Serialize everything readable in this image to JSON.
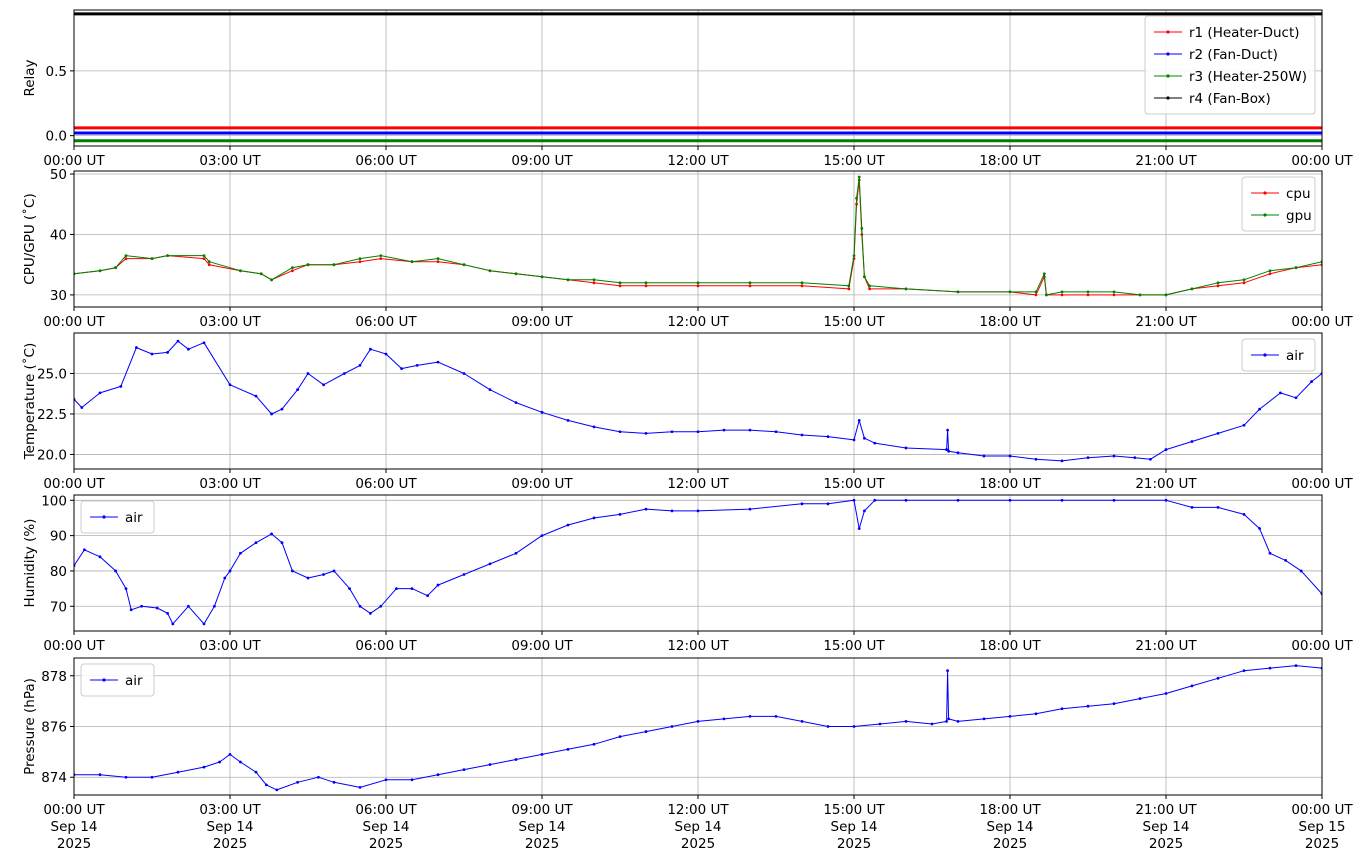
{
  "chart_data": [
    {
      "type": "line",
      "ylabel": "Relay",
      "ylim": [
        -0.08,
        0.97
      ],
      "yticks": [
        0.0,
        0.5
      ],
      "yticklabels": [
        "0.0",
        "0.5"
      ],
      "grid": true,
      "legend_loc": "upper-right",
      "series": [
        {
          "name": "r1 (Heater-Duct)",
          "color": "#ff0000",
          "x": [
            0,
            24
          ],
          "y": [
            0.06,
            0.06
          ]
        },
        {
          "name": "r2 (Fan-Duct)",
          "color": "#0000ff",
          "x": [
            0,
            24
          ],
          "y": [
            0.02,
            0.02
          ]
        },
        {
          "name": "r3 (Heater-250W)",
          "color": "#008000",
          "x": [
            0,
            24
          ],
          "y": [
            -0.04,
            -0.04
          ]
        },
        {
          "name": "r4 (Fan-Box)",
          "color": "#000000",
          "x": [
            0,
            24
          ],
          "y": [
            0.94,
            0.94
          ]
        }
      ]
    },
    {
      "type": "line",
      "ylabel": "CPU/GPU (˚C)",
      "ylim": [
        28,
        50.5
      ],
      "yticks": [
        30,
        40,
        50
      ],
      "yticklabels": [
        "30",
        "40",
        "50"
      ],
      "grid": true,
      "legend_loc": "upper-right",
      "series": [
        {
          "name": "cpu",
          "color": "#ff0000",
          "x": [
            0,
            0.5,
            0.8,
            1.0,
            1.5,
            1.8,
            2.5,
            2.6,
            3.2,
            3.6,
            3.8,
            4.2,
            4.5,
            5.0,
            5.5,
            5.9,
            6.5,
            7.0,
            7.5,
            8.0,
            8.5,
            9.0,
            9.5,
            10.0,
            10.5,
            11.0,
            12.0,
            13.0,
            14.0,
            14.9,
            15.0,
            15.05,
            15.1,
            15.15,
            15.2,
            15.3,
            16.0,
            17.0,
            18.0,
            18.5,
            18.66,
            18.7,
            19.0,
            19.5,
            20.0,
            20.5,
            21.0,
            21.5,
            22.0,
            22.5,
            23.0,
            23.5,
            24.0
          ],
          "y": [
            33.5,
            34.0,
            34.5,
            36.0,
            36.0,
            36.5,
            36.0,
            35.0,
            34.0,
            33.5,
            32.5,
            34.0,
            35.0,
            35.0,
            35.5,
            36.0,
            35.5,
            35.5,
            35.0,
            34.0,
            33.5,
            33.0,
            32.5,
            32.0,
            31.5,
            31.5,
            31.5,
            31.5,
            31.5,
            31.0,
            36.0,
            45.0,
            49.0,
            40.0,
            33.0,
            31.0,
            31.0,
            30.5,
            30.5,
            30.0,
            33.0,
            30.0,
            30.0,
            30.0,
            30.0,
            30.0,
            30.0,
            31.0,
            31.5,
            32.0,
            33.5,
            34.5,
            35.0
          ]
        },
        {
          "name": "gpu",
          "color": "#008000",
          "x": [
            0,
            0.5,
            0.8,
            1.0,
            1.5,
            1.8,
            2.5,
            2.6,
            3.2,
            3.6,
            3.8,
            4.2,
            4.5,
            5.0,
            5.5,
            5.9,
            6.5,
            7.0,
            7.5,
            8.0,
            8.5,
            9.0,
            9.5,
            10.0,
            10.5,
            11.0,
            12.0,
            13.0,
            14.0,
            14.9,
            15.0,
            15.05,
            15.1,
            15.15,
            15.2,
            15.3,
            16.0,
            17.0,
            18.0,
            18.5,
            18.66,
            18.7,
            19.0,
            19.5,
            20.0,
            20.5,
            21.0,
            21.5,
            22.0,
            22.5,
            23.0,
            23.5,
            24.0
          ],
          "y": [
            33.5,
            34.0,
            34.5,
            36.5,
            36.0,
            36.5,
            36.5,
            35.5,
            34.0,
            33.5,
            32.5,
            34.5,
            35.0,
            35.0,
            36.0,
            36.5,
            35.5,
            36.0,
            35.0,
            34.0,
            33.5,
            33.0,
            32.5,
            32.5,
            32.0,
            32.0,
            32.0,
            32.0,
            32.0,
            31.5,
            36.5,
            46.0,
            49.5,
            41.0,
            33.0,
            31.5,
            31.0,
            30.5,
            30.5,
            30.5,
            33.5,
            30.0,
            30.5,
            30.5,
            30.5,
            30.0,
            30.0,
            31.0,
            32.0,
            32.5,
            34.0,
            34.5,
            35.5
          ]
        }
      ]
    },
    {
      "type": "line",
      "ylabel": "Temperature (˚C)",
      "ylim": [
        19.1,
        27.5
      ],
      "yticks": [
        20.0,
        22.5,
        25.0
      ],
      "yticklabels": [
        "20.0",
        "22.5",
        "25.0"
      ],
      "grid": true,
      "legend_loc": "upper-right",
      "series": [
        {
          "name": "air",
          "color": "#0000ff",
          "x": [
            0,
            0.15,
            0.5,
            0.9,
            1.2,
            1.5,
            1.8,
            2.0,
            2.2,
            2.5,
            3.0,
            3.5,
            3.8,
            4.0,
            4.3,
            4.5,
            4.8,
            5.2,
            5.5,
            5.7,
            6.0,
            6.3,
            6.6,
            7.0,
            7.5,
            8.0,
            8.5,
            9.0,
            9.5,
            10.0,
            10.5,
            11.0,
            11.5,
            12.0,
            12.5,
            13.0,
            13.5,
            14.0,
            14.5,
            15.0,
            15.1,
            15.2,
            15.4,
            16.0,
            16.78,
            16.8,
            16.82,
            17.0,
            17.5,
            18.0,
            18.5,
            19.0,
            19.5,
            20.0,
            20.4,
            20.7,
            21.0,
            21.5,
            22.0,
            22.5,
            22.8,
            23.2,
            23.5,
            23.8,
            24.0
          ],
          "y": [
            23.4,
            22.9,
            23.8,
            24.2,
            26.6,
            26.2,
            26.3,
            27.0,
            26.5,
            26.9,
            24.3,
            23.6,
            22.5,
            22.8,
            24.0,
            25.0,
            24.3,
            25.0,
            25.5,
            26.5,
            26.2,
            25.3,
            25.5,
            25.7,
            25.0,
            24.0,
            23.2,
            22.6,
            22.1,
            21.7,
            21.4,
            21.3,
            21.4,
            21.4,
            21.5,
            21.5,
            21.4,
            21.2,
            21.1,
            20.9,
            22.1,
            21.0,
            20.7,
            20.4,
            20.3,
            21.5,
            20.2,
            20.1,
            19.9,
            19.9,
            19.7,
            19.6,
            19.8,
            19.9,
            19.8,
            19.7,
            20.3,
            20.8,
            21.3,
            21.8,
            22.8,
            23.8,
            23.5,
            24.5,
            25.0
          ]
        }
      ]
    },
    {
      "type": "line",
      "ylabel": "Humidity (%)",
      "ylim": [
        63,
        101.5
      ],
      "yticks": [
        70,
        80,
        90,
        100
      ],
      "yticklabels": [
        "70",
        "80",
        "90",
        "100"
      ],
      "grid": true,
      "legend_loc": "upper-left",
      "series": [
        {
          "name": "air",
          "color": "#0000ff",
          "x": [
            0,
            0.2,
            0.5,
            0.8,
            1.0,
            1.1,
            1.3,
            1.6,
            1.8,
            1.9,
            2.2,
            2.5,
            2.7,
            2.9,
            3.0,
            3.2,
            3.5,
            3.8,
            4.0,
            4.2,
            4.5,
            4.8,
            5.0,
            5.3,
            5.5,
            5.7,
            5.9,
            6.2,
            6.5,
            6.8,
            7.0,
            7.5,
            8.0,
            8.5,
            9.0,
            9.5,
            10.0,
            10.5,
            11.0,
            11.5,
            12.0,
            13.0,
            14.0,
            14.5,
            15.0,
            15.1,
            15.2,
            15.4,
            16.0,
            17.0,
            18.0,
            19.0,
            20.0,
            21.0,
            21.5,
            22.0,
            22.5,
            22.8,
            23.0,
            23.3,
            23.6,
            24.0
          ],
          "y": [
            81.5,
            86.0,
            84.0,
            80.0,
            75.0,
            69.0,
            70.0,
            69.5,
            68.0,
            65.0,
            70.0,
            65.0,
            70.0,
            78.0,
            80.0,
            85.0,
            88.0,
            90.5,
            88.0,
            80.0,
            78.0,
            79.0,
            80.0,
            75.0,
            70.0,
            68.0,
            70.0,
            75.0,
            75.0,
            73.0,
            76.0,
            79.0,
            82.0,
            85.0,
            90.0,
            93.0,
            95.0,
            96.0,
            97.5,
            97.0,
            97.0,
            97.5,
            99.0,
            99.0,
            100.0,
            92.0,
            97.0,
            100.0,
            100.0,
            100.0,
            100.0,
            100.0,
            100.0,
            100.0,
            98.0,
            98.0,
            96.0,
            92.0,
            85.0,
            83.0,
            80.0,
            73.5
          ]
        }
      ]
    },
    {
      "type": "line",
      "ylabel": "Pressure (hPa)",
      "ylim": [
        873.3,
        878.7
      ],
      "yticks": [
        874,
        876,
        878
      ],
      "yticklabels": [
        "874",
        "876",
        "878"
      ],
      "grid": true,
      "legend_loc": "upper-left",
      "xticklabels": [
        "00:00 UT\nSep 14\n2025",
        "03:00 UT\nSep 14\n2025",
        "06:00 UT\nSep 14\n2025",
        "09:00 UT\nSep 14\n2025",
        "12:00 UT\nSep 14\n2025",
        "15:00 UT\nSep 14\n2025",
        "18:00 UT\nSep 14\n2025",
        "21:00 UT\nSep 14\n2025",
        "00:00 UT\nSep 15\n2025"
      ],
      "series": [
        {
          "name": "air",
          "color": "#0000ff",
          "x": [
            0,
            0.5,
            1.0,
            1.5,
            2.0,
            2.5,
            2.8,
            3.0,
            3.2,
            3.5,
            3.7,
            3.9,
            4.3,
            4.7,
            5.0,
            5.5,
            6.0,
            6.5,
            7.0,
            7.5,
            8.0,
            8.5,
            9.0,
            9.5,
            10.0,
            10.5,
            11.0,
            11.5,
            12.0,
            12.5,
            13.0,
            13.5,
            14.0,
            14.5,
            15.0,
            15.5,
            16.0,
            16.5,
            16.78,
            16.8,
            16.82,
            17.0,
            17.5,
            18.0,
            18.5,
            19.0,
            19.5,
            20.0,
            20.5,
            21.0,
            21.5,
            22.0,
            22.5,
            23.0,
            23.5,
            24.0
          ],
          "y": [
            874.1,
            874.1,
            874.0,
            874.0,
            874.2,
            874.4,
            874.6,
            874.9,
            874.6,
            874.2,
            873.7,
            873.5,
            873.8,
            874.0,
            873.8,
            873.6,
            873.9,
            873.9,
            874.1,
            874.3,
            874.5,
            874.7,
            874.9,
            875.1,
            875.3,
            875.6,
            875.8,
            876.0,
            876.2,
            876.3,
            876.4,
            876.4,
            876.2,
            876.0,
            876.0,
            876.1,
            876.2,
            876.1,
            876.2,
            878.2,
            876.3,
            876.2,
            876.3,
            876.4,
            876.5,
            876.7,
            876.8,
            876.9,
            877.1,
            877.3,
            877.6,
            877.9,
            878.2,
            878.3,
            878.4,
            878.3
          ]
        }
      ]
    }
  ],
  "xaxis": {
    "ticklabels": [
      "00:00 UT",
      "03:00 UT",
      "06:00 UT",
      "09:00 UT",
      "12:00 UT",
      "15:00 UT",
      "18:00 UT",
      "21:00 UT",
      "00:00 UT"
    ]
  }
}
